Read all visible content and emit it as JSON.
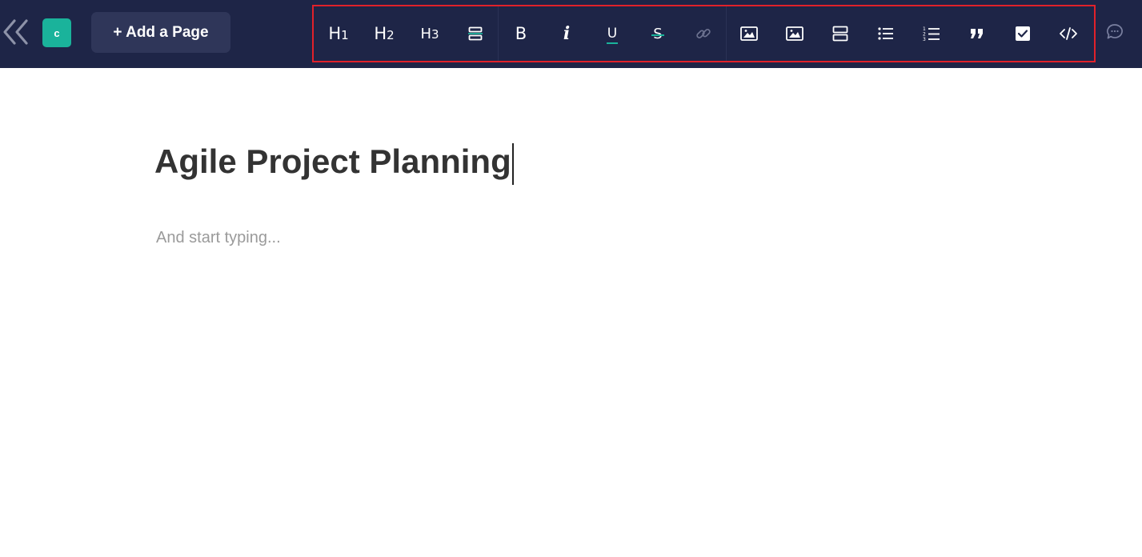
{
  "header": {
    "workspace_initial": "c",
    "add_page_label": "+ Add a Page"
  },
  "toolbar": {
    "h1": {
      "main": "H",
      "sub": "1"
    },
    "h2": {
      "main": "H",
      "sub": "2"
    },
    "h3": {
      "main": "H",
      "sub": "3"
    },
    "bold": "B",
    "italic": "i",
    "underline": "U",
    "strike": "S"
  },
  "document": {
    "title": "Agile Project Planning",
    "body_placeholder": "And start typing..."
  },
  "colors": {
    "topbar": "#1e2547",
    "accent_teal": "#1ab39b",
    "toolbar_highlight": "#e0212a",
    "title_text": "#333333",
    "placeholder_text": "#9a9a9a"
  }
}
